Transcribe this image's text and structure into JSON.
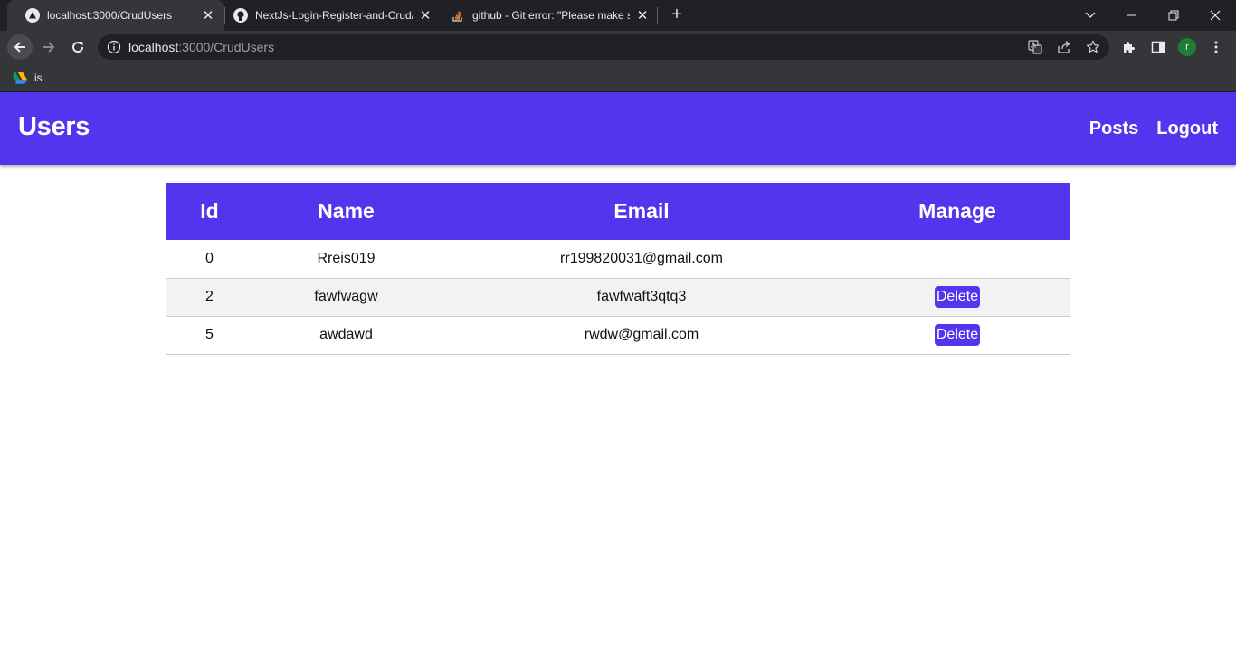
{
  "browser": {
    "tabs": [
      {
        "title": "localhost:3000/CrudUsers",
        "icon": "triangle-app-icon",
        "active": true
      },
      {
        "title": "NextJs-Login-Register-and-Crud/",
        "icon": "github-icon",
        "active": false
      },
      {
        "title": "github - Git error: \"Please make s",
        "icon": "stackoverflow-icon",
        "active": false
      }
    ],
    "close_glyph": "✕",
    "new_tab_glyph": "+",
    "address": {
      "host": "localhost",
      "rest": ":3000/CrudUsers"
    },
    "bookmarks": [
      {
        "label": "is",
        "icon": "google-drive-icon"
      }
    ],
    "profile_initial": "r",
    "colors": {
      "chrome_dark": "#202124",
      "chrome_toolbar": "#35363a",
      "profile": "#1e7e34"
    }
  },
  "app": {
    "title": "Users",
    "nav": {
      "posts": "Posts",
      "logout": "Logout"
    },
    "accent": "#5236ee"
  },
  "table": {
    "headers": {
      "id": "Id",
      "name": "Name",
      "email": "Email",
      "manage": "Manage"
    },
    "rows": [
      {
        "id": "0",
        "name": "Rreis019",
        "email": "rr199820031@gmail.com",
        "action": ""
      },
      {
        "id": "2",
        "name": "fawfwagw",
        "email": "fawfwaft3qtq3",
        "action": "Delete"
      },
      {
        "id": "5",
        "name": "awdawd",
        "email": "rwdw@gmail.com",
        "action": "Delete"
      }
    ]
  }
}
